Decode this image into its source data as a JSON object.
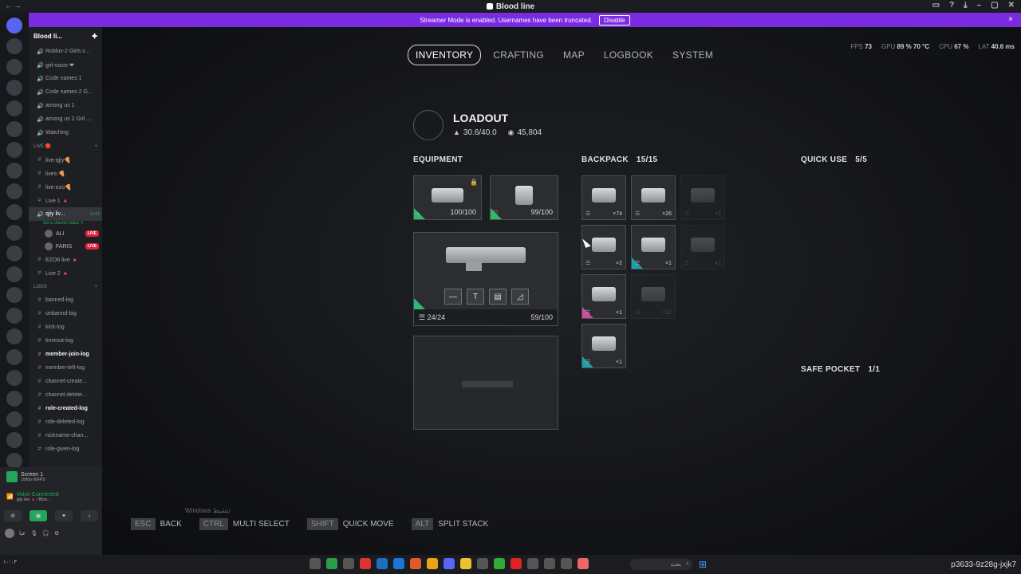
{
  "window": {
    "title": "Blood line",
    "left_nav": "←  →"
  },
  "banner": {
    "text": "Streamer Mode is enabled. Usernames have been truncated.",
    "disable_label": "Disable",
    "close_glyph": "×"
  },
  "sidebar": {
    "server_name": "Blood li...",
    "top_channels": [
      {
        "label": "Roblox-2 Girls v..."
      },
      {
        "label": "girl-voice ❤"
      },
      {
        "label": "Code names 1"
      },
      {
        "label": "Code names 2 G..."
      },
      {
        "label": "among us 1"
      },
      {
        "label": "among us 2 Girl ..."
      },
      {
        "label": "Watching"
      }
    ],
    "live_category": "LIVE 🔴",
    "live_channels": [
      {
        "label": "live-qjiy🍕"
      },
      {
        "label": "lives-🍕"
      },
      {
        "label": "live-ezo🍕"
      },
      {
        "label": "Live 1 🔺"
      }
    ],
    "active_voice": {
      "label": "qjiy liv...",
      "sub": "Set a channel status ✎",
      "timer": "14:08"
    },
    "voice_users": [
      {
        "name": "ALI",
        "tag": "LIVE"
      },
      {
        "name": "FARIS",
        "tag": "LIVE"
      }
    ],
    "more_live": [
      {
        "label": "EZO6 live 🔺"
      },
      {
        "label": "Live 2 🔺"
      }
    ],
    "logs_category": "LOGS",
    "log_channels": [
      {
        "label": "banned-log",
        "bold": false
      },
      {
        "label": "unbannd-log",
        "bold": false
      },
      {
        "label": "kick-log",
        "bold": false
      },
      {
        "label": "timeout-log",
        "bold": false
      },
      {
        "label": "member-join-log",
        "bold": true
      },
      {
        "label": "member-left-log",
        "bold": false
      },
      {
        "label": "channel-create...",
        "bold": false
      },
      {
        "label": "channel-delete...",
        "bold": false
      },
      {
        "label": "role-created-log",
        "bold": true
      },
      {
        "label": "role-deleted-log",
        "bold": false
      },
      {
        "label": "nickname-chan...",
        "bold": false
      },
      {
        "label": "role-given-log",
        "bold": false
      }
    ]
  },
  "bottom_panel": {
    "screen_label": "Screen 1",
    "screen_sub": "1080p 60FPS",
    "voice_label": "Voice Connected",
    "voice_sub": "qjiy live 🔺 / Bloo...",
    "user_label": "عبا"
  },
  "game": {
    "tabs": [
      "INVENTORY",
      "CRAFTING",
      "MAP",
      "LOGBOOK",
      "SYSTEM"
    ],
    "active_tab": "INVENTORY",
    "perf": {
      "fps_label": "FPS",
      "fps": "73",
      "gpu_label": "GPU",
      "gpu": "89 % 70 °C",
      "cpu_label": "CPU",
      "cpu": "67 %",
      "lat_label": "LAT",
      "lat": "40.6 ms"
    },
    "loadout": {
      "title": "LOADOUT",
      "weight": "30.6/40.0",
      "credits": "45,804"
    },
    "equipment": {
      "title": "EQUIPMENT",
      "shield_durability": "100/100",
      "augment_durability": "99/100",
      "weapon_ammo": "24/24",
      "weapon_durability": "59/100"
    },
    "backpack": {
      "title": "BACKPACK",
      "count": "15/15",
      "slots": [
        {
          "qty": "×74"
        },
        {
          "qty": "×26"
        },
        {
          "qty": "×1"
        },
        {
          "qty": "×2"
        },
        {
          "qty": "×1"
        },
        {
          "qty": "×1"
        },
        {
          "qty": "×1"
        },
        {
          "qty": "×12"
        },
        {
          "qty": "×1"
        }
      ]
    },
    "quick_use": {
      "title": "QUICK USE",
      "count": "5/5"
    },
    "safe_pocket": {
      "title": "SAFE POCKET",
      "count": "1/1"
    },
    "hints": [
      {
        "key": "ESC",
        "label": "BACK"
      },
      {
        "key": "CTRL",
        "label": "MULTI SELECT"
      },
      {
        "key": "SHIFT",
        "label": "QUICK MOVE"
      },
      {
        "key": "ALT",
        "label": "SPLIT STACK"
      }
    ],
    "activate_text": "Windows تنشيط"
  },
  "taskbar": {
    "search_placeholder": "بحث",
    "tray_text": "p3633-9z28g-jxjk7",
    "clock": "١٠:٠٣"
  }
}
